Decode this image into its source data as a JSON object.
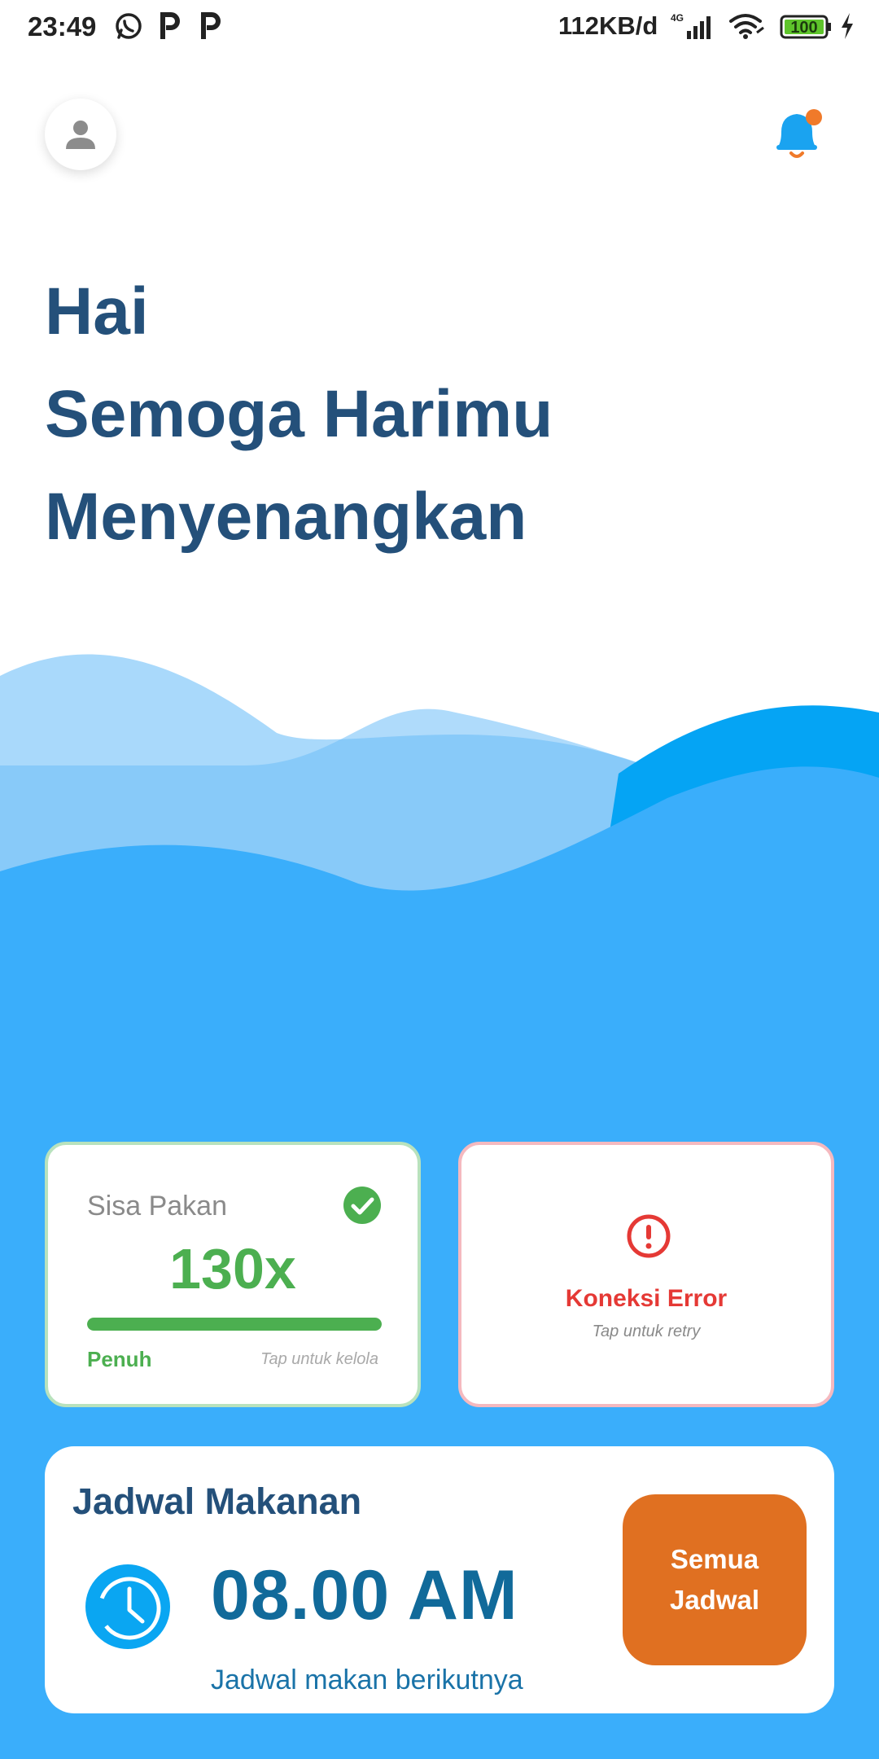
{
  "status_bar": {
    "time": "23:49",
    "net_speed": "112KB/d",
    "network_type": "4G",
    "battery": "100",
    "app_icons": [
      "whatsapp-icon",
      "p-app-icon",
      "p-app-icon"
    ]
  },
  "header": {
    "avatar_icon": "person-icon",
    "bell_icon": "notification-bell-icon",
    "bell_has_dot": true
  },
  "greeting": {
    "line1": "Hai",
    "line2": "Semoga Harimu",
    "line3": "Menyenangkan"
  },
  "feed_card": {
    "label": "Sisa Pakan",
    "value": "130x",
    "status": "Penuh",
    "hint": "Tap untuk kelola",
    "level_percent": 100,
    "status_icon": "check-circle-icon"
  },
  "error_card": {
    "title": "Koneksi Error",
    "hint": "Tap untuk retry",
    "icon": "alert-circle-icon"
  },
  "schedule": {
    "title": "Jadwal Makanan",
    "time": "08.00 AM",
    "subtitle": "Jadwal makan berikutnya",
    "button_label": "Semua Jadwal",
    "icon": "clock-icon"
  },
  "colors": {
    "primary_text": "#24507a",
    "wave_blue": "#3aaefb",
    "success": "#4caf50",
    "error": "#e53935",
    "accent": "#e07021"
  }
}
